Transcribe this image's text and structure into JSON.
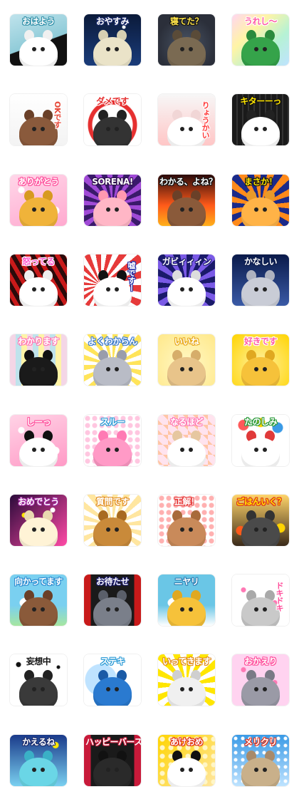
{
  "stickers": [
    {
      "caption": "おはよう",
      "bg": "#bfe3ec",
      "bg2": "#8fcbd8",
      "animal": "#ffffff",
      "ear": "#f0f0f0",
      "text": "#ffffff",
      "stroke": "#2f8fa8",
      "style": "mint",
      "vertical": false
    },
    {
      "caption": "おやすみ",
      "bg": "#0b1a3a",
      "bg2": "#1a3c7a",
      "animal": "#eae3c8",
      "ear": "#d6cfb2",
      "text": "#ffffff",
      "stroke": "#1a2a6a",
      "style": "night",
      "vertical": false
    },
    {
      "caption": "寝てた？",
      "bg": "#2b2f3a",
      "bg2": "#4a5566",
      "animal": "#7a6a52",
      "ear": "#5a4b38",
      "text": "#ffe54a",
      "stroke": "#111111",
      "style": "owl",
      "vertical": false
    },
    {
      "caption": "うれし～",
      "bg": "#ffd6f0",
      "bg2": "#b6f2d4",
      "animal": "#35a34a",
      "ear": "#2a8a3c",
      "text": "#ff5aa6",
      "stroke": "#ffffff",
      "style": "rainbow",
      "vertical": false
    },
    {
      "caption": "OKです",
      "bg": "#ffffff",
      "bg2": "#f3f3f3",
      "animal": "#8a5a3c",
      "ear": "#6a4028",
      "text": "#e64a3a",
      "stroke": "#ffffff",
      "style": "white",
      "vertical": true
    },
    {
      "caption": "ダメです",
      "bg": "#ffffff",
      "bg2": "#ffe1e1",
      "animal": "#333333",
      "ear": "#222222",
      "text": "#e63030",
      "stroke": "#ffffff",
      "style": "nosign",
      "vertical": false
    },
    {
      "caption": "りょうかい",
      "bg": "#f7f7f7",
      "bg2": "#ffc6c6",
      "animal": "#ffffff",
      "ear": "#f1d6d6",
      "text": "#ff3a3a",
      "stroke": "#ffffff",
      "style": "white",
      "vertical": true
    },
    {
      "caption": "キターーっ",
      "bg": "#1a1a1a",
      "bg2": "#ffe600",
      "animal": "#ffffff",
      "ear": "#222222",
      "text": "#ffe600",
      "stroke": "#111111",
      "style": "cow",
      "vertical": false
    },
    {
      "caption": "ありがとう",
      "bg": "#ffd7e9",
      "bg2": "#ffa9cf",
      "animal": "#f0b33a",
      "ear": "#d79a20",
      "text": "#ffffff",
      "stroke": "#ff4c9a",
      "style": "sakura",
      "vertical": false
    },
    {
      "caption": "SORENA!",
      "bg": "#3a1a6a",
      "bg2": "#a04ad6",
      "animal": "#ffb6c6",
      "ear": "#ff98b0",
      "text": "#ffffff",
      "stroke": "#2a0a4a",
      "style": "purple",
      "vertical": false
    },
    {
      "caption": "わかる、よね？",
      "bg": "#2a0a0a",
      "bg2": "#ff5a1a",
      "animal": "#8a5a3a",
      "ear": "#6a4028",
      "text": "#ffffff",
      "stroke": "#111111",
      "style": "fire",
      "vertical": false
    },
    {
      "caption": "まさか！",
      "bg": "#1b2a8a",
      "bg2": "#ff8a1a",
      "animal": "#ffb347",
      "ear": "#e89a2a",
      "text": "#ffe600",
      "stroke": "#111111",
      "style": "burst",
      "vertical": false
    },
    {
      "caption": "怒ってる",
      "bg": "#2a0a0a",
      "bg2": "#c81a1a",
      "animal": "#ffffff",
      "ear": "#eeeeee",
      "text": "#ff5ad0",
      "stroke": "#ffffff",
      "style": "angry",
      "vertical": false
    },
    {
      "caption": "嘘ですー",
      "bg": "#ffffff",
      "bg2": "#e63a3a",
      "animal": "#ffffff",
      "ear": "#111111",
      "text": "#ffffff",
      "stroke": "#1a2aa6",
      "style": "panda",
      "vertical": true
    },
    {
      "caption": "ガビィィィン",
      "bg": "#1a1a6a",
      "bg2": "#7a5ae6",
      "animal": "#ffffff",
      "ear": "#dddddd",
      "text": "#ffffff",
      "stroke": "#1a1a6a",
      "style": "shock",
      "vertical": false
    },
    {
      "caption": "かなしい",
      "bg": "#0a1a4a",
      "bg2": "#3a5aa6",
      "animal": "#c9ccd6",
      "ear": "#aeb2bf",
      "text": "#ffffff",
      "stroke": "#0a1a4a",
      "style": "sad",
      "vertical": false
    },
    {
      "caption": "わかります",
      "bg": "#f4d6e6",
      "bg2": "#bfe3ec",
      "animal": "#1a1a1a",
      "ear": "#111111",
      "text": "#ffffff",
      "stroke": "#ff78b4",
      "style": "stripe",
      "vertical": false
    },
    {
      "caption": "よくわからん",
      "bg": "#ffe45a",
      "bg2": "#ffffff",
      "animal": "#b9bcc6",
      "ear": "#9a9dab",
      "text": "#ffffff",
      "stroke": "#3a7ad0",
      "style": "radial",
      "vertical": false
    },
    {
      "caption": "いいね",
      "bg": "#fff8c6",
      "bg2": "#ffe88a",
      "animal": "#e8c48a",
      "ear": "#d6ad6a",
      "text": "#ffffff",
      "stroke": "#e8a81a",
      "style": "yellow",
      "vertical": false
    },
    {
      "caption": "好きです",
      "bg": "#fff1a6",
      "bg2": "#ffd400",
      "animal": "#f6c23a",
      "ear": "#e0a820",
      "text": "#ff5aa6",
      "stroke": "#ffffff",
      "style": "lion",
      "vertical": false
    },
    {
      "caption": "しーっ",
      "bg": "#ffd3e6",
      "bg2": "#ff9ac6",
      "animal": "#ffffff",
      "ear": "#111111",
      "text": "#ffffff",
      "stroke": "#ff4c9a",
      "style": "pink",
      "vertical": false
    },
    {
      "caption": "スルー",
      "bg": "#ffffff",
      "bg2": "#ffc6e0",
      "animal": "#ff9ac6",
      "ear": "#ff7ab4",
      "text": "#ffffff",
      "stroke": "#2a9ad6",
      "style": "dots",
      "vertical": false
    },
    {
      "caption": "なるほど",
      "bg": "#ffe3ee",
      "bg2": "#ffc6a6",
      "animal": "#ffffff",
      "ear": "#e6c7a0",
      "text": "#ffffff",
      "stroke": "#ff78b4",
      "style": "diamond",
      "vertical": false
    },
    {
      "caption": "たのしみ",
      "bg": "#ffffff",
      "bg2": "#ffe6a0",
      "animal": "#ffffff",
      "ear": "#e03a3a",
      "text": "#ffffff",
      "stroke": "#2a9a3a",
      "style": "balloon",
      "vertical": false
    },
    {
      "caption": "おめでとう",
      "bg": "#2a0a3a",
      "bg2": "#ff4aa6",
      "animal": "#fff3d6",
      "ear": "#e9d9b0",
      "text": "#ffffff",
      "stroke": "#a02aa0",
      "style": "sparkle",
      "vertical": false
    },
    {
      "caption": "質問です",
      "bg": "#ffe6a0",
      "bg2": "#ffffff",
      "animal": "#c98a3a",
      "ear": "#a86a20",
      "text": "#ffffff",
      "stroke": "#e08a1a",
      "style": "radial",
      "vertical": false
    },
    {
      "caption": "正解！",
      "bg": "#ffffff",
      "bg2": "#ffb0b0",
      "animal": "#c98a5a",
      "ear": "#a86a3a",
      "text": "#ffffff",
      "stroke": "#e63a3a",
      "style": "dots",
      "vertical": false
    },
    {
      "caption": "ごはんいく？",
      "bg": "#3a2a1a",
      "bg2": "#ffd46a",
      "animal": "#4a4a4a",
      "ear": "#333333",
      "text": "#ffe600",
      "stroke": "#e0301a",
      "style": "flowers",
      "vertical": false
    },
    {
      "caption": "向かってます",
      "bg": "#7ad0f0",
      "bg2": "#a6e6a0",
      "animal": "#8a5a3a",
      "ear": "#6a4028",
      "text": "#ffffff",
      "stroke": "#2a8ad0",
      "style": "sky",
      "vertical": false
    },
    {
      "caption": "お待たせ",
      "bg": "#1a1a1a",
      "bg2": "#c81a1a",
      "animal": "#7a7f8a",
      "ear": "#5a5f6a",
      "text": "#ffffff",
      "stroke": "#1a1a6a",
      "style": "stage",
      "vertical": false
    },
    {
      "caption": "ニヤリ",
      "bg": "#6ac6e6",
      "bg2": "#ffffff",
      "animal": "#f6c23a",
      "ear": "#e0a820",
      "text": "#ffffff",
      "stroke": "#2a7ab0",
      "style": "sky2",
      "vertical": false
    },
    {
      "caption": "ドキドキ",
      "bg": "#ffffff",
      "bg2": "#ffd3e6",
      "animal": "#c9c9c9",
      "ear": "#a9a9a9",
      "text": "#ff4c9a",
      "stroke": "#ffffff",
      "style": "hearts",
      "vertical": true
    },
    {
      "caption": "妄想中",
      "bg": "#ffffff",
      "bg2": "#e6e6e6",
      "animal": "#3a3a3a",
      "ear": "#222222",
      "text": "#111111",
      "stroke": "#ffffff",
      "style": "mono",
      "vertical": false
    },
    {
      "caption": "ステキ",
      "bg": "#ffffff",
      "bg2": "#bfe3ff",
      "animal": "#2a7ad0",
      "ear": "#1a5aa6",
      "text": "#ffffff",
      "stroke": "#2a9ad6",
      "style": "peacock",
      "vertical": false
    },
    {
      "caption": "いってきます",
      "bg": "#ffe600",
      "bg2": "#ffffff",
      "animal": "#f0f0f0",
      "ear": "#cfcfcf",
      "text": "#ffffff",
      "stroke": "#e08a1a",
      "style": "rays",
      "vertical": false
    },
    {
      "caption": "おかえり",
      "bg": "#ffd3f0",
      "bg2": "#ffffff",
      "animal": "#9a9aa6",
      "ear": "#7a7a86",
      "text": "#ffffff",
      "stroke": "#ff4c9a",
      "style": "hearts",
      "vertical": false
    },
    {
      "caption": "かえるね",
      "bg": "#1a3a8a",
      "bg2": "#7ad0f0",
      "animal": "#6ad6e6",
      "ear": "#3ab0c6",
      "text": "#ffffff",
      "stroke": "#1a2a6a",
      "style": "space",
      "vertical": false
    },
    {
      "caption": "ハッピーバースデ",
      "bg": "#1a1a1a",
      "bg2": "#c81a3a",
      "animal": "#2a2a2a",
      "ear": "#111111",
      "text": "#ffffff",
      "stroke": "#c81a3a",
      "style": "stage",
      "vertical": false
    },
    {
      "caption": "あけおめ",
      "bg": "#ffd400",
      "bg2": "#ffe6a0",
      "animal": "#ffffff",
      "ear": "#111111",
      "text": "#ffffff",
      "stroke": "#e0301a",
      "style": "gold",
      "vertical": false
    },
    {
      "caption": "メリクリ",
      "bg": "#3a9ae6",
      "bg2": "#bfe3ff",
      "animal": "#c9b08a",
      "ear": "#a88a6a",
      "text": "#ffffff",
      "stroke": "#e0301a",
      "style": "xmas",
      "vertical": false
    }
  ]
}
